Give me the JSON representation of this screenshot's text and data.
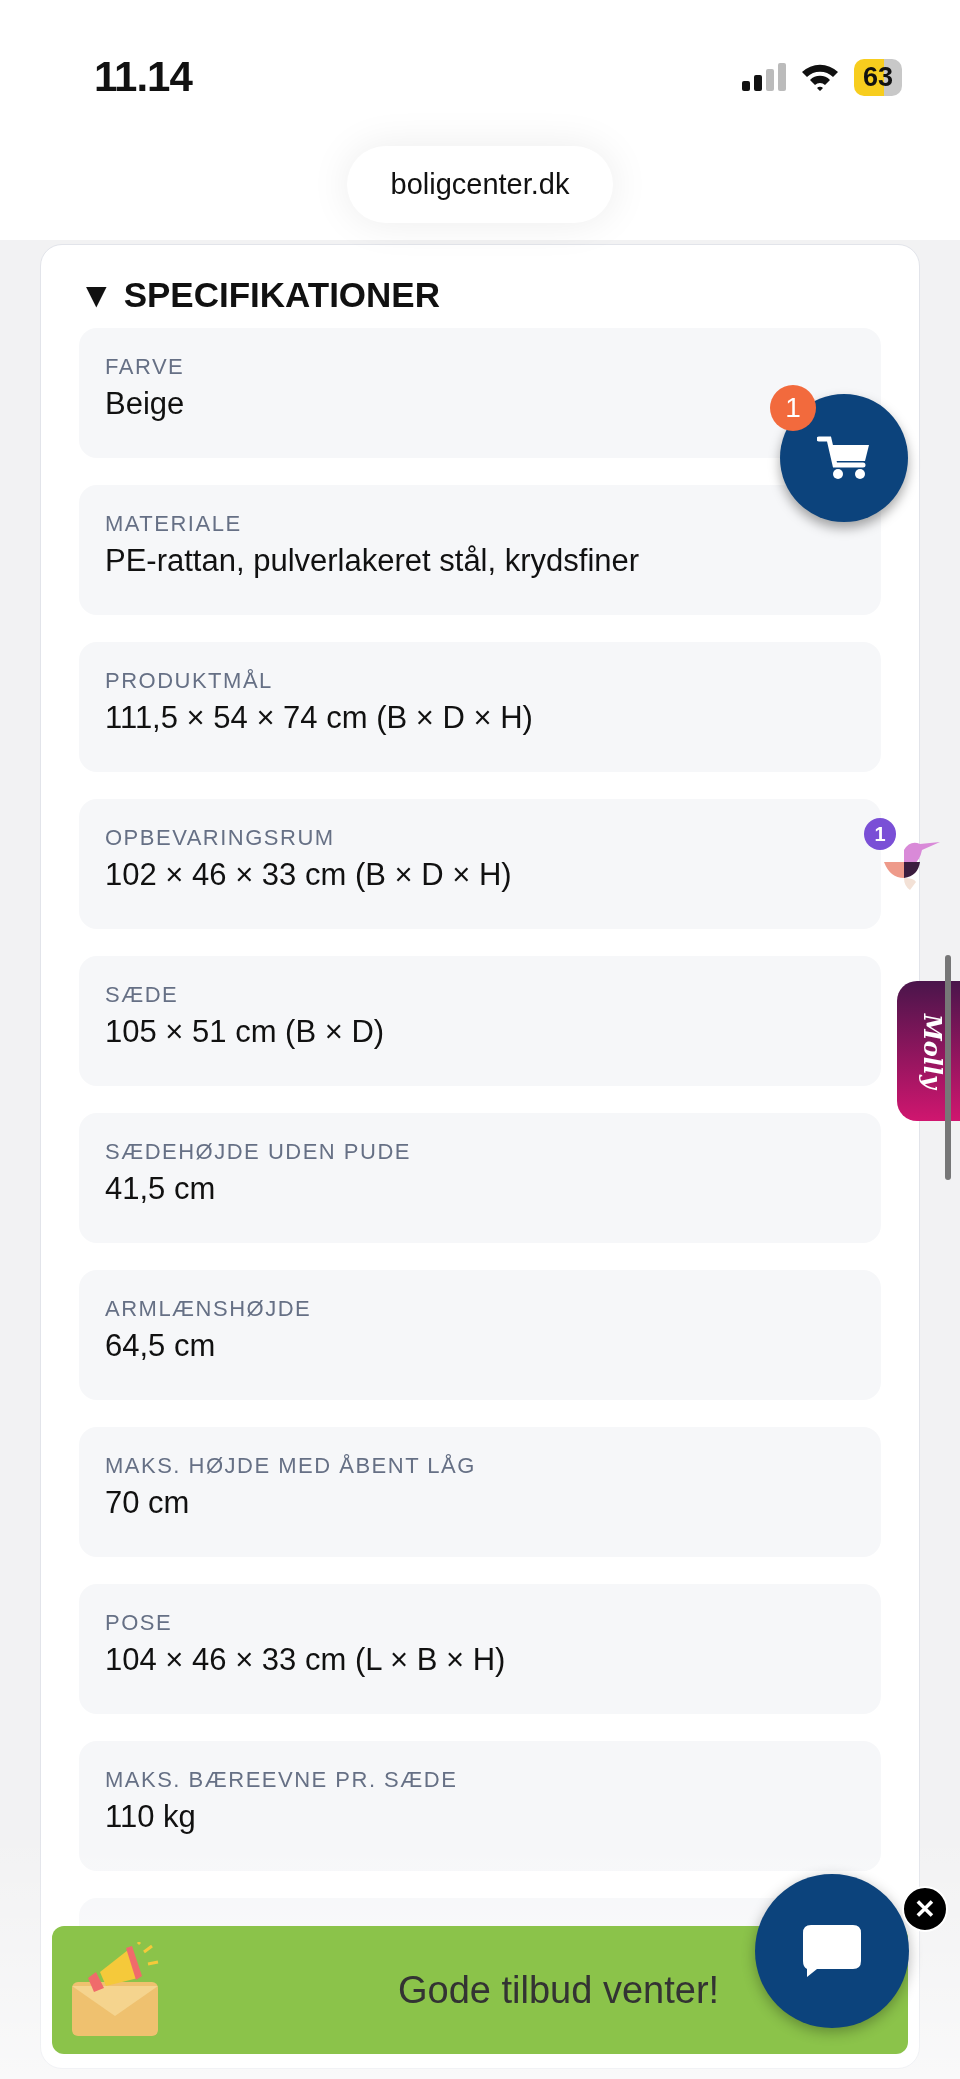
{
  "status_bar": {
    "time": "11.14",
    "battery": "63"
  },
  "address_bar": {
    "url": "boligcenter.dk"
  },
  "specifications": {
    "toggle": "▼",
    "title": "SPECIFIKATIONER",
    "expanded": true,
    "items": [
      {
        "label": "FARVE",
        "value": "Beige"
      },
      {
        "label": "MATERIALE",
        "value": "PE-rattan, pulverlakeret stål, krydsfiner"
      },
      {
        "label": "PRODUKTMÅL",
        "value": "111,5 × 54 × 74 cm (B × D × H)"
      },
      {
        "label": "OPBEVARINGSRUM",
        "value": "102 × 46 × 33 cm (B × D × H)"
      },
      {
        "label": "SÆDE",
        "value": "105 × 51 cm (B × D)"
      },
      {
        "label": "SÆDEHØJDE UDEN PUDE",
        "value": "41,5 cm"
      },
      {
        "label": "ARMLÆNSHØJDE",
        "value": "64,5 cm"
      },
      {
        "label": "MAKS. HØJDE MED ÅBENT LÅG",
        "value": "70 cm"
      },
      {
        "label": "POSE",
        "value": "104 × 46 × 33 cm (L × B × H)"
      },
      {
        "label": "MAKS. BÆREEVNE PR. SÆDE",
        "value": "110 kg"
      }
    ]
  },
  "cart": {
    "badge": "1"
  },
  "assistant": {
    "badge": "1",
    "tab_label": "Molly"
  },
  "promo_banner": {
    "text": "Gode tilbud venter!"
  },
  "chat": {
    "close": "✕"
  }
}
